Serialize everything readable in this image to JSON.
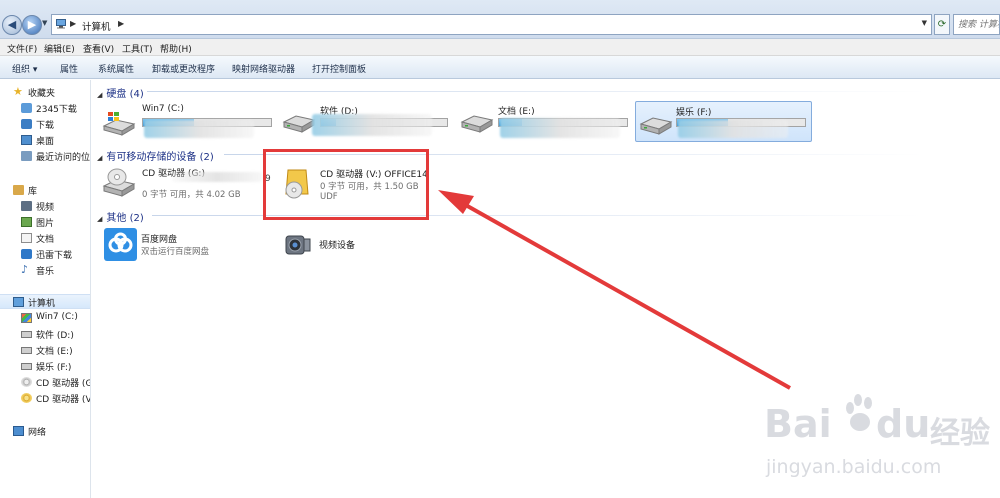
{
  "address": {
    "path_root": "计算机",
    "search_placeholder": "搜索 计算机"
  },
  "menu": {
    "file": "文件(F)",
    "edit": "编辑(E)",
    "view": "查看(V)",
    "tools": "工具(T)",
    "help": "帮助(H)"
  },
  "commands": {
    "organize": "组织 ▾",
    "properties": "属性",
    "system_properties": "系统属性",
    "uninstall": "卸载或更改程序",
    "map_drive": "映射网络驱动器",
    "control_panel": "打开控制面板"
  },
  "sidebar": {
    "favorites": "收藏夹",
    "fav_items": [
      "2345下载",
      "下载",
      "桌面",
      "最近访问的位置"
    ],
    "libraries": "库",
    "lib_items": [
      "视频",
      "图片",
      "文档",
      "迅雷下载",
      "音乐"
    ],
    "computer": "计算机",
    "computer_items": [
      "Win7 (C:)",
      "软件 (D:)",
      "文档 (E:)",
      "娱乐 (F:)",
      "CD 驱动器 (G:)",
      "CD 驱动器 (V:)"
    ],
    "network": "网络"
  },
  "groups": {
    "hard_disks": "硬盘 (4)",
    "removable": "有可移动存储的设备 (2)",
    "other": "其他 (2)"
  },
  "drives": [
    {
      "name": "Win7 (C:)",
      "used_fraction": 0.4
    },
    {
      "name": "软件 (D:)",
      "used_fraction": 0.12
    },
    {
      "name": "文档 (E:)",
      "used_fraction": 0.18
    },
    {
      "name": "娱乐 (F:)",
      "used_fraction": 0.4
    }
  ],
  "removable": [
    {
      "name": "CD 驱动器 (G:)",
      "sub": "0 字节 可用，共 4.02 GB",
      "trail": "9"
    },
    {
      "name": "CD 驱动器 (V:) OFFICE14",
      "sub": "0 字节 可用，共 1.50 GB",
      "sub2": "UDF"
    }
  ],
  "other": [
    {
      "name": "百度网盘",
      "sub": "双击运行百度网盘"
    },
    {
      "name": "视频设备"
    }
  ],
  "watermark": {
    "brand": "Bai",
    "brand2": "du",
    "cn": "经验",
    "url": "jingyan.baidu.com"
  },
  "colors": {
    "highlight": "#e33a3a",
    "group_header": "#1e3287",
    "selection": "#cfe4fb"
  }
}
